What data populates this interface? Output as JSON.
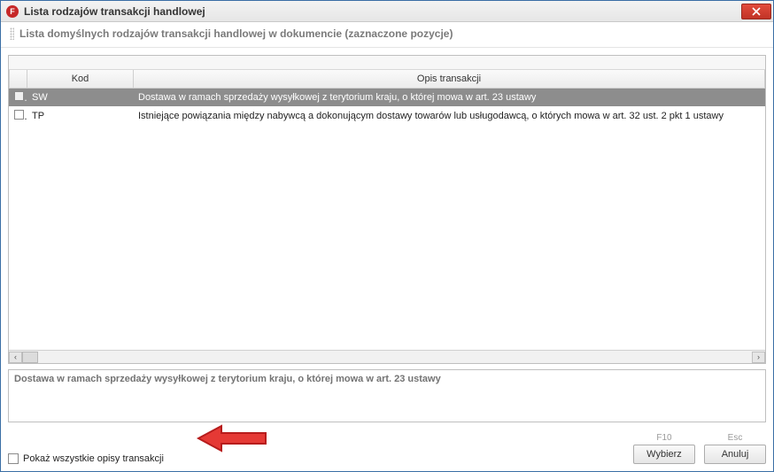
{
  "window": {
    "title": "Lista rodzajów transakcji handlowej",
    "app_icon_letter": "F"
  },
  "subheader": {
    "text": "Lista domyślnych rodzajów transakcji handlowej w dokumencie (zaznaczone pozycje)"
  },
  "grid": {
    "columns": {
      "kod": "Kod",
      "opis": "Opis transakcji"
    },
    "rows": [
      {
        "checked": false,
        "selected": true,
        "kod": "SW",
        "opis": "Dostawa w ramach sprzedaży wysyłkowej z terytorium kraju, o której mowa w art. 23 ustawy"
      },
      {
        "checked": false,
        "selected": false,
        "kod": "TP",
        "opis": "Istniejące powiązania między nabywcą a dokonującym dostawy towarów lub usługodawcą, o których mowa w art. 32 ust. 2 pkt 1 ustawy"
      }
    ]
  },
  "detail": {
    "text": "Dostawa w ramach sprzedaży wysyłkowej z terytorium kraju, o której mowa w art. 23 ustawy"
  },
  "footer": {
    "show_all_label": "Pokaż wszystkie opisy transakcji",
    "buttons": {
      "select": {
        "hint": "F10",
        "label": "Wybierz"
      },
      "cancel": {
        "hint": "Esc",
        "label": "Anuluj"
      }
    }
  }
}
